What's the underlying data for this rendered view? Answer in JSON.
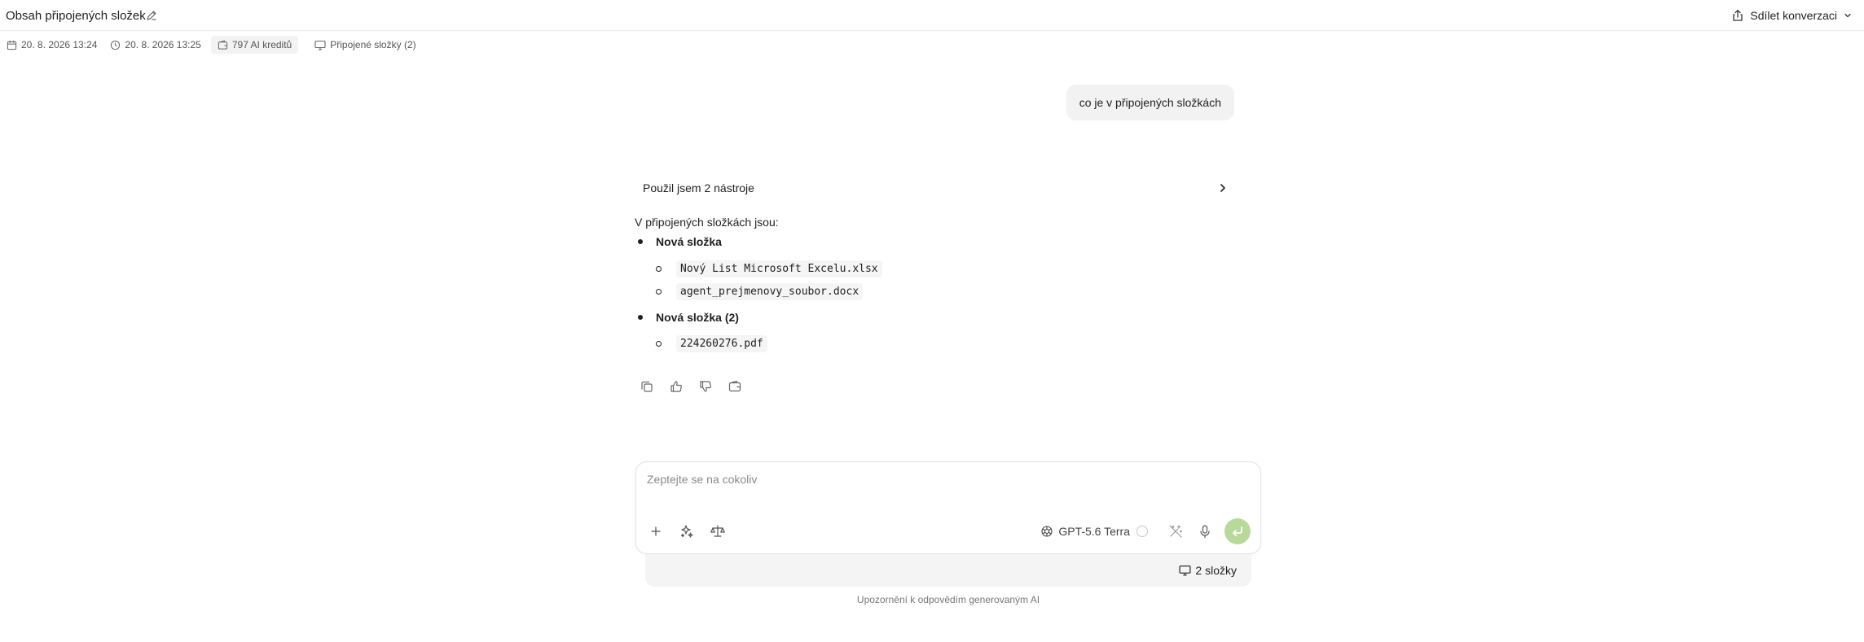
{
  "header": {
    "title": "Obsah připojených složek",
    "share_label": "Sdílet konverzaci"
  },
  "meta": {
    "created": "20. 8. 2026 13:24",
    "updated": "20. 8. 2026 13:25",
    "credits": "797 AI kreditů",
    "attached_folders": "Připojené složky (2)"
  },
  "conversation": {
    "user_message": "co je v připojených složkách",
    "tools_label": "Použil jsem 2 nástroje",
    "intro": "V připojených složkách jsou:",
    "folders": [
      {
        "name": "Nová složka",
        "files": [
          "Nový List Microsoft Excelu.xlsx",
          "agent_prejmenovy_soubor.docx"
        ]
      },
      {
        "name": "Nová složka (2)",
        "files": [
          "224260276.pdf"
        ]
      }
    ]
  },
  "composer": {
    "placeholder": "Zeptejte se na cokoliv",
    "model": "GPT-5.6 Terra",
    "folders_count": "2 složky"
  },
  "disclaimer": "Upozornění k odpovědím generovaným AI",
  "icons": {
    "edit": "pencil-icon",
    "share": "share-icon",
    "calendar": "calendar-icon",
    "clock": "clock-icon",
    "wallet": "wallet-icon",
    "monitor": "monitor-icon",
    "chevron": "chevron-right-icon",
    "copy": "copy-icon",
    "like": "thumbs-up-icon",
    "dislike": "thumbs-down-icon",
    "plus": "plus-icon",
    "sparkles": "sparkles-icon",
    "scale": "scale-icon",
    "model": "openai-icon",
    "wand": "magic-wand-icon",
    "mic": "microphone-icon",
    "send": "enter-icon"
  },
  "colors": {
    "send_button": "#b9d99a",
    "bubble": "#f2f2f2",
    "folders_bar": "#f4f4f4"
  }
}
